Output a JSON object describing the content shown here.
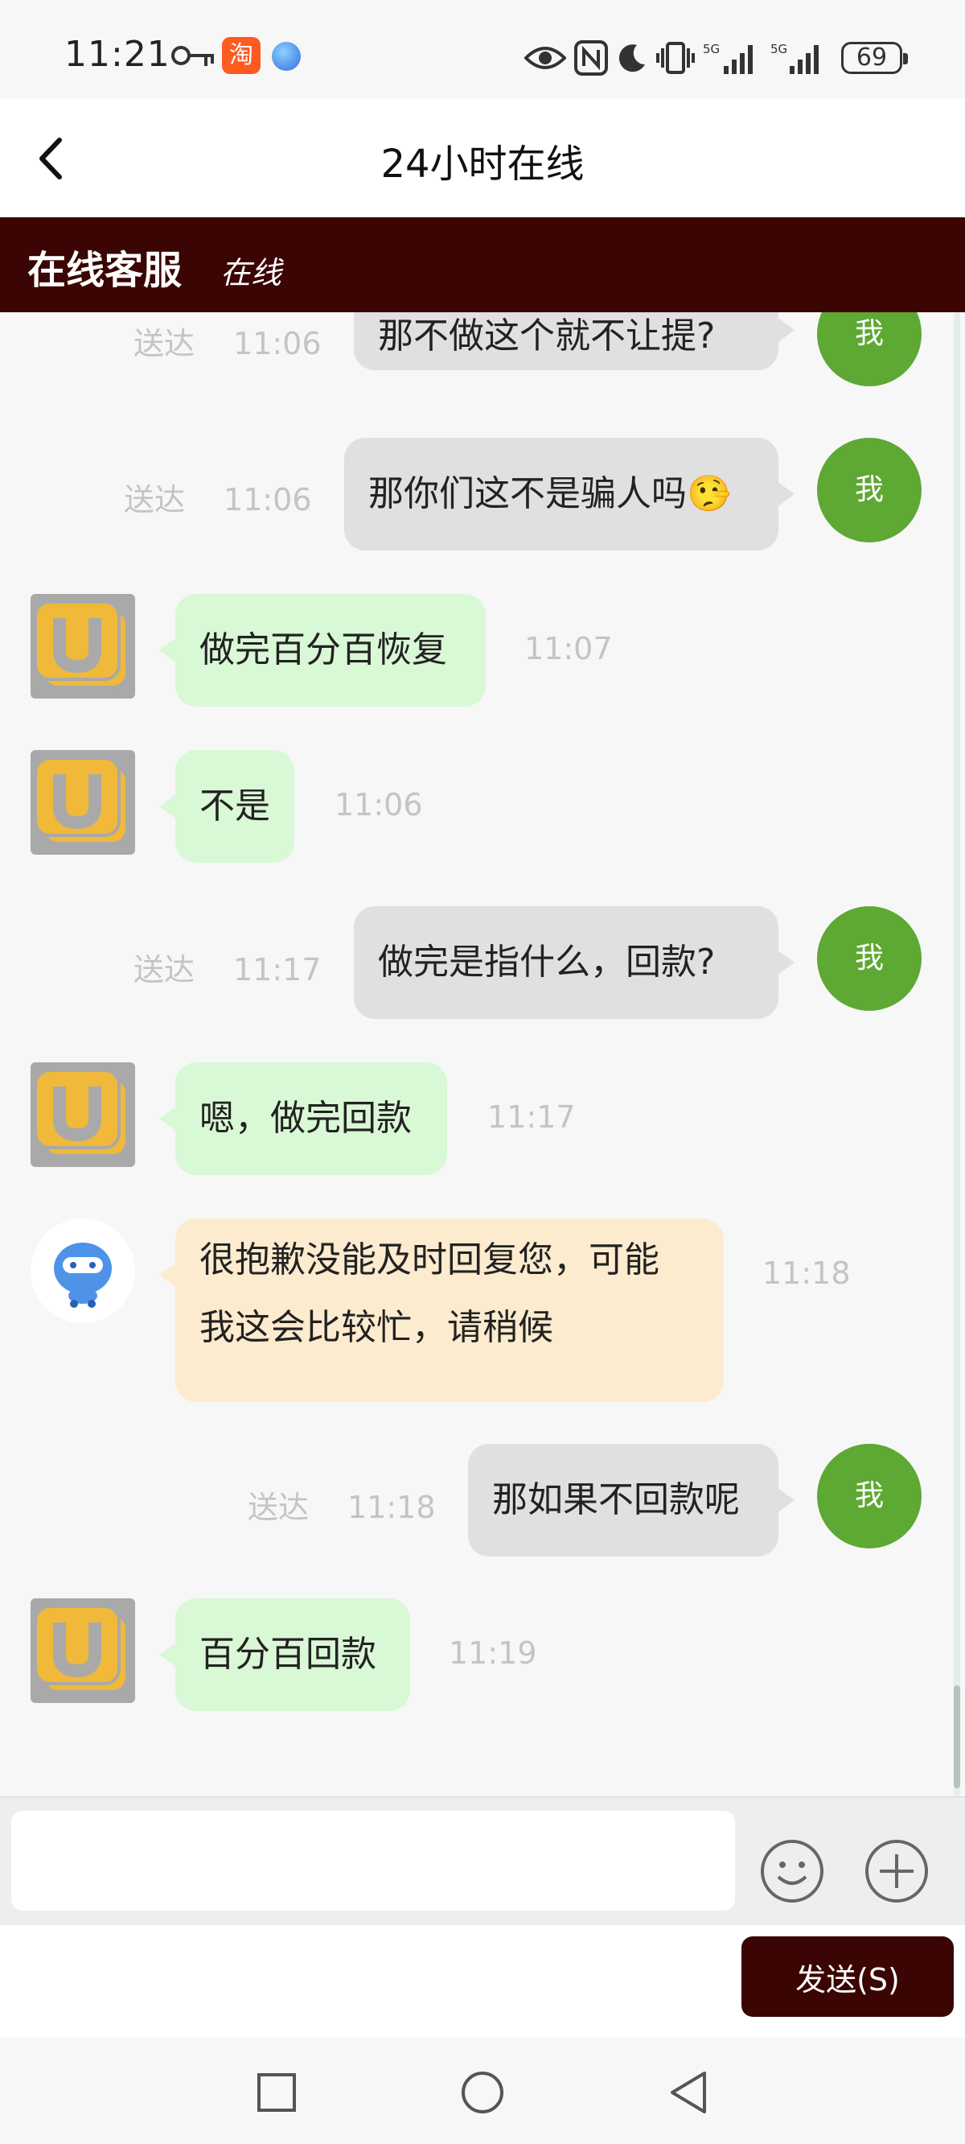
{
  "status_bar": {
    "time": "11:21",
    "taobao_label": "淘",
    "battery": "69",
    "signal_1": "5G",
    "signal_2": "5G"
  },
  "nav": {
    "title": "24小时在线"
  },
  "service": {
    "title": "在线客服",
    "status": "在线"
  },
  "chat": {
    "me_label": "我",
    "messages": [
      {
        "from": "me",
        "text": "那不做这个就不让提?",
        "status": "送达",
        "time": "11:06"
      },
      {
        "from": "me",
        "text": "那你们这不是骗人吗",
        "emoji": "🤥",
        "status": "送达",
        "time": "11:06"
      },
      {
        "from": "agent",
        "text": "做完百分百恢复",
        "time": "11:07"
      },
      {
        "from": "agent",
        "text": "不是",
        "time": "11:06"
      },
      {
        "from": "me",
        "text": "做完是指什么，回款?",
        "status": "送达",
        "time": "11:17"
      },
      {
        "from": "agent",
        "text": "嗯，做完回款",
        "time": "11:17"
      },
      {
        "from": "bot",
        "text_line1": "很抱歉没能及时回复您，可能",
        "text_line2": "我这会比较忙，请稍候",
        "time": "11:18"
      },
      {
        "from": "me",
        "text": "那如果不回款呢",
        "status": "送达",
        "time": "11:18"
      },
      {
        "from": "agent",
        "text": "百分百回款",
        "time": "11:19"
      }
    ]
  },
  "input": {
    "value": "",
    "placeholder": ""
  },
  "send": {
    "label": "发送(S)"
  },
  "colors": {
    "brand_dark": "#3a0503",
    "me_avatar": "#5ea834",
    "agent_bubble": "#d9f8d6",
    "my_bubble": "#e0e0e0",
    "bot_bubble": "#fdebcf",
    "agent_avatar_logo": "#f0b93a"
  },
  "icons": {
    "status": [
      "key-icon",
      "taobao-icon",
      "browser-icon",
      "eye-icon",
      "nfc-icon",
      "moon-icon",
      "vibrate-icon",
      "signal-icon",
      "battery-icon"
    ],
    "input": [
      "emoji-icon",
      "plus-icon"
    ],
    "system": [
      "recent-apps-icon",
      "home-icon",
      "back-triangle-icon"
    ]
  }
}
